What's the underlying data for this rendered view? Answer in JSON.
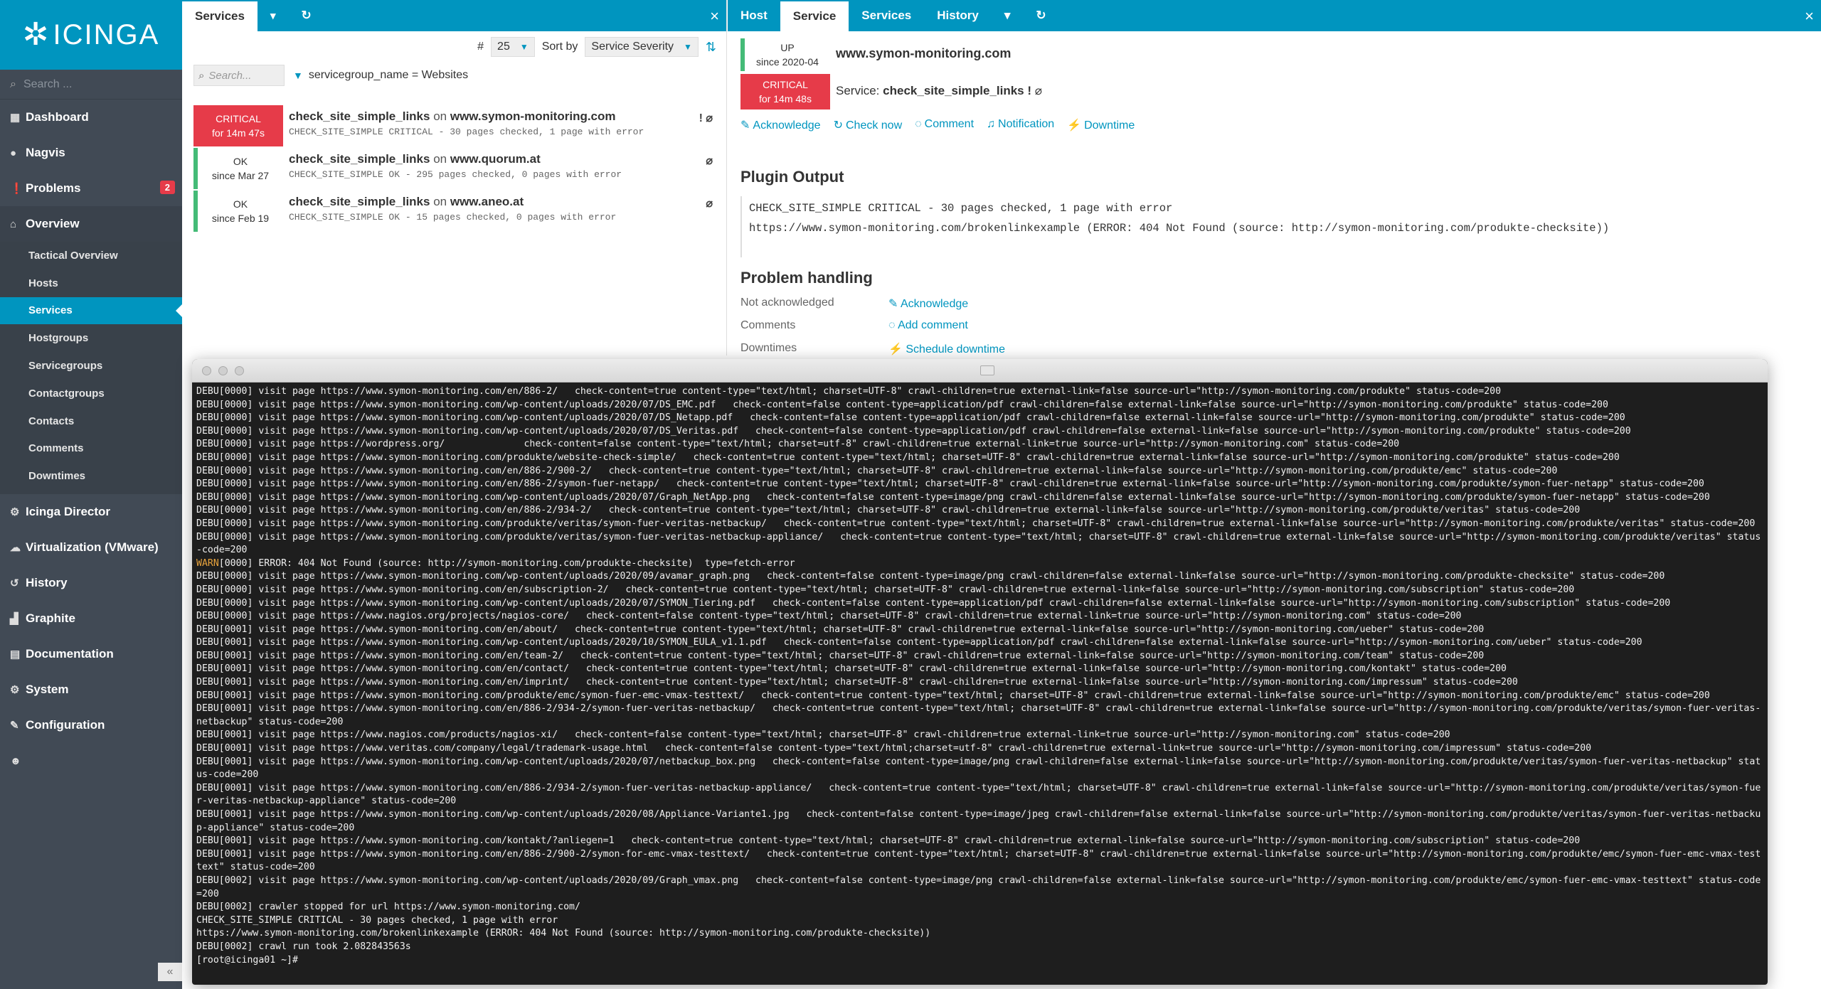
{
  "sidebar": {
    "logo_text": "ICINGA",
    "search_placeholder": "Search ...",
    "items": [
      {
        "label": "Dashboard",
        "icon": "dashboard-icon"
      },
      {
        "label": "Nagvis",
        "icon": "nagvis-icon"
      },
      {
        "label": "Problems",
        "icon": "problems-icon",
        "badge": "2"
      },
      {
        "label": "Overview",
        "icon": "overview-icon"
      }
    ],
    "overview_sub": [
      "Tactical Overview",
      "Hosts",
      "Services",
      "Hostgroups",
      "Servicegroups",
      "Contactgroups",
      "Contacts",
      "Comments",
      "Downtimes"
    ],
    "items_after": [
      {
        "label": "Icinga Director",
        "icon": "director-icon"
      },
      {
        "label": "Virtualization (VMware)",
        "icon": "vmware-icon"
      },
      {
        "label": "History",
        "icon": "history-icon"
      },
      {
        "label": "Graphite",
        "icon": "graphite-icon"
      },
      {
        "label": "Documentation",
        "icon": "documentation-icon"
      },
      {
        "label": "System",
        "icon": "system-icon"
      },
      {
        "label": "Configuration",
        "icon": "configuration-icon"
      },
      {
        "label": "",
        "icon": "user-icon"
      }
    ],
    "collapse_label": "«"
  },
  "services_panel": {
    "tab_label": "Services",
    "limit_label": "#",
    "limit_value": "25",
    "sort_label": "Sort by",
    "sort_value": "Service Severity",
    "search_placeholder": "Search...",
    "filter_text": "servicegroup_name = Websites",
    "rows": [
      {
        "state": "CRITICAL",
        "since": "for 14m 47s",
        "service": "check_site_simple_links",
        "on": "on",
        "host": "www.symon-monitoring.com",
        "output": "CHECK_SITE_SIMPLE CRITICAL - 30 pages checked, 1 page with error",
        "flags": "! ⌀"
      },
      {
        "state": "OK",
        "since": "since Mar 27",
        "service": "check_site_simple_links",
        "on": "on",
        "host": "www.quorum.at",
        "output": "CHECK_SITE_SIMPLE OK - 295 pages checked, 0 pages with error",
        "flags": "⌀"
      },
      {
        "state": "OK",
        "since": "since Feb 19",
        "service": "check_site_simple_links",
        "on": "on",
        "host": "www.aneo.at",
        "output": "CHECK_SITE_SIMPLE OK - 15 pages checked, 0 pages with error",
        "flags": "⌀"
      }
    ]
  },
  "detail_panel": {
    "tabs": [
      "Host",
      "Service",
      "Services",
      "History"
    ],
    "host_state": "UP",
    "host_since": "since 2020-04",
    "host_name": "www.symon-monitoring.com",
    "service_state": "CRITICAL",
    "service_since": "for 14m 48s",
    "service_prefix": "Service:",
    "service_name": "check_site_simple_links",
    "service_flags": "!",
    "actions": [
      "Acknowledge",
      "Check now",
      "Comment",
      "Notification",
      "Downtime"
    ],
    "plugin_output_title": "Plugin Output",
    "plugin_output_lines": [
      "CHECK_SITE_SIMPLE CRITICAL - 30 pages checked, 1 page with error",
      "https://www.symon-monitoring.com/brokenlinkexample (ERROR: 404 Not Found (source: http://symon-monitoring.com/produkte-checksite))"
    ],
    "problem_handling_title": "Problem handling",
    "problem_rows": [
      {
        "key": "Not acknowledged",
        "value": "Acknowledge"
      },
      {
        "key": "Comments",
        "value": "Add comment"
      },
      {
        "key": "Downtimes",
        "value": "Schedule downtime"
      }
    ]
  },
  "terminal": {
    "lines": [
      "DEBU[0000] visit page https://www.symon-monitoring.com/en/886-2/   check-content=true content-type=\"text/html; charset=UTF-8\" crawl-children=true external-link=false source-url=\"http://symon-monitoring.com/produkte\" status-code=200",
      "DEBU[0000] visit page https://www.symon-monitoring.com/wp-content/uploads/2020/07/DS_EMC.pdf   check-content=false content-type=application/pdf crawl-children=false external-link=false source-url=\"http://symon-monitoring.com/produkte\" status-code=200",
      "DEBU[0000] visit page https://www.symon-monitoring.com/wp-content/uploads/2020/07/DS_Netapp.pdf   check-content=false content-type=application/pdf crawl-children=false external-link=false source-url=\"http://symon-monitoring.com/produkte\" status-code=200",
      "DEBU[0000] visit page https://www.symon-monitoring.com/wp-content/uploads/2020/07/DS_Veritas.pdf   check-content=false content-type=application/pdf crawl-children=false external-link=false source-url=\"http://symon-monitoring.com/produkte\" status-code=200",
      "DEBU[0000] visit page https://wordpress.org/              check-content=false content-type=\"text/html; charset=utf-8\" crawl-children=true external-link=true source-url=\"http://symon-monitoring.com\" status-code=200",
      "DEBU[0000] visit page https://www.symon-monitoring.com/produkte/website-check-simple/   check-content=true content-type=\"text/html; charset=UTF-8\" crawl-children=true external-link=false source-url=\"http://symon-monitoring.com/produkte\" status-code=200",
      "DEBU[0000] visit page https://www.symon-monitoring.com/en/886-2/900-2/   check-content=true content-type=\"text/html; charset=UTF-8\" crawl-children=true external-link=false source-url=\"http://symon-monitoring.com/produkte/emc\" status-code=200",
      "DEBU[0000] visit page https://www.symon-monitoring.com/en/886-2/symon-fuer-netapp/   check-content=true content-type=\"text/html; charset=UTF-8\" crawl-children=true external-link=false source-url=\"http://symon-monitoring.com/produkte/symon-fuer-netapp\" status-code=200",
      "DEBU[0000] visit page https://www.symon-monitoring.com/wp-content/uploads/2020/07/Graph_NetApp.png   check-content=false content-type=image/png crawl-children=false external-link=false source-url=\"http://symon-monitoring.com/produkte/symon-fuer-netapp\" status-code=200",
      "DEBU[0000] visit page https://www.symon-monitoring.com/en/886-2/934-2/   check-content=true content-type=\"text/html; charset=UTF-8\" crawl-children=true external-link=false source-url=\"http://symon-monitoring.com/produkte/veritas\" status-code=200",
      "DEBU[0000] visit page https://www.symon-monitoring.com/produkte/veritas/symon-fuer-veritas-netbackup/   check-content=true content-type=\"text/html; charset=UTF-8\" crawl-children=true external-link=false source-url=\"http://symon-monitoring.com/produkte/veritas\" status-code=200",
      "DEBU[0000] visit page https://www.symon-monitoring.com/produkte/veritas/symon-fuer-veritas-netbackup-appliance/   check-content=true content-type=\"text/html; charset=UTF-8\" crawl-children=true external-link=false source-url=\"http://symon-monitoring.com/produkte/veritas\" status-code=200",
      "WARN[0000] ERROR: 404 Not Found (source: http://symon-monitoring.com/produkte-checksite)  type=fetch-error",
      "DEBU[0000] visit page https://www.symon-monitoring.com/wp-content/uploads/2020/09/avamar_graph.png   check-content=false content-type=image/png crawl-children=false external-link=false source-url=\"http://symon-monitoring.com/produkte-checksite\" status-code=200",
      "DEBU[0000] visit page https://www.symon-monitoring.com/en/subscription-2/   check-content=true content-type=\"text/html; charset=UTF-8\" crawl-children=true external-link=false source-url=\"http://symon-monitoring.com/subscription\" status-code=200",
      "DEBU[0000] visit page https://www.symon-monitoring.com/wp-content/uploads/2020/07/SYMON_Tiering.pdf   check-content=false content-type=application/pdf crawl-children=false external-link=false source-url=\"http://symon-monitoring.com/subscription\" status-code=200",
      "DEBU[0000] visit page https://www.nagios.org/projects/nagios-core/   check-content=false content-type=\"text/html; charset=UTF-8\" crawl-children=true external-link=true source-url=\"http://symon-monitoring.com\" status-code=200",
      "DEBU[0001] visit page https://www.symon-monitoring.com/en/about/   check-content=true content-type=\"text/html; charset=UTF-8\" crawl-children=true external-link=false source-url=\"http://symon-monitoring.com/ueber\" status-code=200",
      "DEBU[0001] visit page https://www.symon-monitoring.com/wp-content/uploads/2020/10/SYMON_EULA_v1.1.pdf   check-content=false content-type=application/pdf crawl-children=false external-link=false source-url=\"http://symon-monitoring.com/ueber\" status-code=200",
      "DEBU[0001] visit page https://www.symon-monitoring.com/en/team-2/   check-content=true content-type=\"text/html; charset=UTF-8\" crawl-children=true external-link=false source-url=\"http://symon-monitoring.com/team\" status-code=200",
      "DEBU[0001] visit page https://www.symon-monitoring.com/en/contact/   check-content=true content-type=\"text/html; charset=UTF-8\" crawl-children=true external-link=false source-url=\"http://symon-monitoring.com/kontakt\" status-code=200",
      "DEBU[0001] visit page https://www.symon-monitoring.com/en/imprint/   check-content=true content-type=\"text/html; charset=UTF-8\" crawl-children=true external-link=false source-url=\"http://symon-monitoring.com/impressum\" status-code=200",
      "DEBU[0001] visit page https://www.symon-monitoring.com/produkte/emc/symon-fuer-emc-vmax-testtext/   check-content=true content-type=\"text/html; charset=UTF-8\" crawl-children=true external-link=false source-url=\"http://symon-monitoring.com/produkte/emc\" status-code=200",
      "DEBU[0001] visit page https://www.symon-monitoring.com/en/886-2/934-2/symon-fuer-veritas-netbackup/   check-content=true content-type=\"text/html; charset=UTF-8\" crawl-children=true external-link=false source-url=\"http://symon-monitoring.com/produkte/veritas/symon-fuer-veritas-netbackup\" status-code=200",
      "DEBU[0001] visit page https://www.nagios.com/products/nagios-xi/   check-content=false content-type=\"text/html; charset=UTF-8\" crawl-children=true external-link=true source-url=\"http://symon-monitoring.com\" status-code=200",
      "DEBU[0001] visit page https://www.veritas.com/company/legal/trademark-usage.html   check-content=false content-type=\"text/html;charset=utf-8\" crawl-children=true external-link=true source-url=\"http://symon-monitoring.com/impressum\" status-code=200",
      "DEBU[0001] visit page https://www.symon-monitoring.com/wp-content/uploads/2020/07/netbackup_box.png   check-content=false content-type=image/png crawl-children=false external-link=false source-url=\"http://symon-monitoring.com/produkte/veritas/symon-fuer-veritas-netbackup\" status-code=200",
      "DEBU[0001] visit page https://www.symon-monitoring.com/en/886-2/934-2/symon-fuer-veritas-netbackup-appliance/   check-content=true content-type=\"text/html; charset=UTF-8\" crawl-children=true external-link=false source-url=\"http://symon-monitoring.com/produkte/veritas/symon-fuer-veritas-netbackup-appliance\" status-code=200",
      "DEBU[0001] visit page https://www.symon-monitoring.com/wp-content/uploads/2020/08/Appliance-Variante1.jpg   check-content=false content-type=image/jpeg crawl-children=false external-link=false source-url=\"http://symon-monitoring.com/produkte/veritas/symon-fuer-veritas-netbackup-appliance\" status-code=200",
      "DEBU[0001] visit page https://www.symon-monitoring.com/kontakt/?anliegen=1   check-content=true content-type=\"text/html; charset=UTF-8\" crawl-children=true external-link=false source-url=\"http://symon-monitoring.com/subscription\" status-code=200",
      "DEBU[0001] visit page https://www.symon-monitoring.com/en/886-2/900-2/symon-for-emc-vmax-testtext/   check-content=true content-type=\"text/html; charset=UTF-8\" crawl-children=true external-link=false source-url=\"http://symon-monitoring.com/produkte/emc/symon-fuer-emc-vmax-testtext\" status-code=200",
      "DEBU[0002] visit page https://www.symon-monitoring.com/wp-content/uploads/2020/09/Graph_vmax.png   check-content=false content-type=image/png crawl-children=false external-link=false source-url=\"http://symon-monitoring.com/produkte/emc/symon-fuer-emc-vmax-testtext\" status-code=200",
      "DEBU[0002] crawler stopped for url https://www.symon-monitoring.com/",
      "CHECK_SITE_SIMPLE CRITICAL - 30 pages checked, 1 page with error",
      "https://www.symon-monitoring.com/brokenlinkexample (ERROR: 404 Not Found (source: http://symon-monitoring.com/produkte-checksite))",
      "DEBU[0002] crawl run took 2.082843563s",
      "[root@icinga01 ~]# "
    ]
  },
  "colors": {
    "brand": "#0095bf",
    "sidebar": "#414a55",
    "critical": "#e63b49",
    "ok": "#44bb77",
    "terminal_bg": "#1e1e1e"
  }
}
